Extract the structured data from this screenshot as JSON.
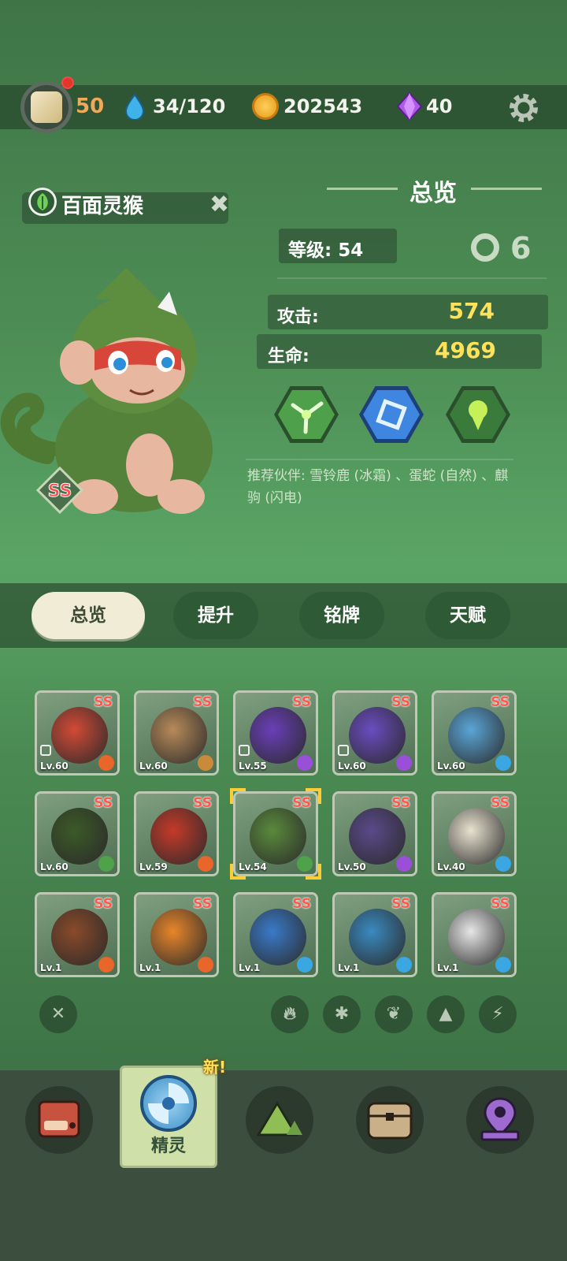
{
  "topbar": {
    "level": "50",
    "water": "34/120",
    "coins": "202543",
    "gems": "40",
    "icons": [
      "avatar",
      "water-drop-icon",
      "coin-icon",
      "gem-icon",
      "gear-icon"
    ]
  },
  "pet": {
    "name": "百面灵猴",
    "rarity": "SS",
    "element_icon": "leaf-icon"
  },
  "overview": {
    "title": "总览",
    "level_label": "等级: 54",
    "attack_label": "攻击:",
    "attack_value": "574",
    "hp_label": "生命:",
    "hp_value": "4969",
    "skills": [
      "wind-skill-icon",
      "frame-skill-icon",
      "pin-skill-icon"
    ],
    "partner_text": "推荐伙伴: 雪铃鹿 (冰霜) 、蛋蛇 (自然) 、麒驹 (闪电)"
  },
  "tabs": [
    {
      "label": "总览",
      "active": true
    },
    {
      "label": "提升",
      "active": false
    },
    {
      "label": "铭牌",
      "active": false
    },
    {
      "label": "天赋",
      "active": false
    }
  ],
  "colors": {
    "accent_yellow": "#ffe15a",
    "ss_red": "#ff5a4f",
    "fire": "#e8662a",
    "lightning": "#9a4fd8",
    "ice": "#3aa7e3",
    "nature": "#4ea34a",
    "earth": "#c98a3a"
  },
  "grid": [
    {
      "rarity": "SS",
      "level": "Lv.60",
      "element": "fire",
      "color": "#d24a36",
      "locked": true,
      "rainbow": true
    },
    {
      "rarity": "SS",
      "level": "Lv.60",
      "element": "earth",
      "color": "#b78a5a",
      "locked": false,
      "rainbow": false
    },
    {
      "rarity": "SS",
      "level": "Lv.55",
      "element": "lightning",
      "color": "#6a3fb8",
      "locked": true,
      "rainbow": false
    },
    {
      "rarity": "SS",
      "level": "Lv.60",
      "element": "lightning",
      "color": "#6a4cc0",
      "locked": true,
      "rainbow": true
    },
    {
      "rarity": "SS",
      "level": "Lv.60",
      "element": "ice",
      "color": "#5aa6d8",
      "locked": false,
      "rainbow": false
    },
    {
      "rarity": "SS",
      "level": "Lv.60",
      "element": "nature",
      "color": "#3c5a28",
      "locked": false,
      "rainbow": false
    },
    {
      "rarity": "SS",
      "level": "Lv.59",
      "element": "fire",
      "color": "#c53a2a",
      "locked": false,
      "rainbow": false
    },
    {
      "rarity": "SS",
      "level": "Lv.54",
      "element": "nature",
      "color": "#5a8a3c",
      "locked": false,
      "rainbow": false,
      "selected": true
    },
    {
      "rarity": "SS",
      "level": "Lv.50",
      "element": "lightning",
      "color": "#5a4a8a",
      "locked": false,
      "rainbow": false
    },
    {
      "rarity": "SS",
      "level": "Lv.40",
      "element": "ice",
      "color": "#e8e2d0",
      "locked": false,
      "rainbow": false
    },
    {
      "rarity": "SS",
      "level": "Lv.1",
      "element": "fire",
      "color": "#8a4a2a",
      "locked": false,
      "rainbow": false
    },
    {
      "rarity": "SS",
      "level": "Lv.1",
      "element": "fire",
      "color": "#e8862a",
      "locked": false,
      "rainbow": false
    },
    {
      "rarity": "SS",
      "level": "Lv.1",
      "element": "ice",
      "color": "#3a7ac8",
      "locked": false,
      "rainbow": false
    },
    {
      "rarity": "SS",
      "level": "Lv.1",
      "element": "ice",
      "color": "#3a8ac0",
      "locked": false,
      "rainbow": false
    },
    {
      "rarity": "SS",
      "level": "Lv.1",
      "element": "ice",
      "color": "#e6e6e6",
      "locked": false,
      "rainbow": false
    }
  ],
  "filters": [
    "close-icon",
    "fire-icon",
    "ice-icon",
    "leaf-icon",
    "earth-icon",
    "lightning-icon"
  ],
  "nav": {
    "items": [
      "battle-icon",
      "pet-icon",
      "mountain-icon",
      "chest-icon",
      "map-pin-icon"
    ],
    "active_label": "精灵",
    "new_tag": "新!"
  }
}
